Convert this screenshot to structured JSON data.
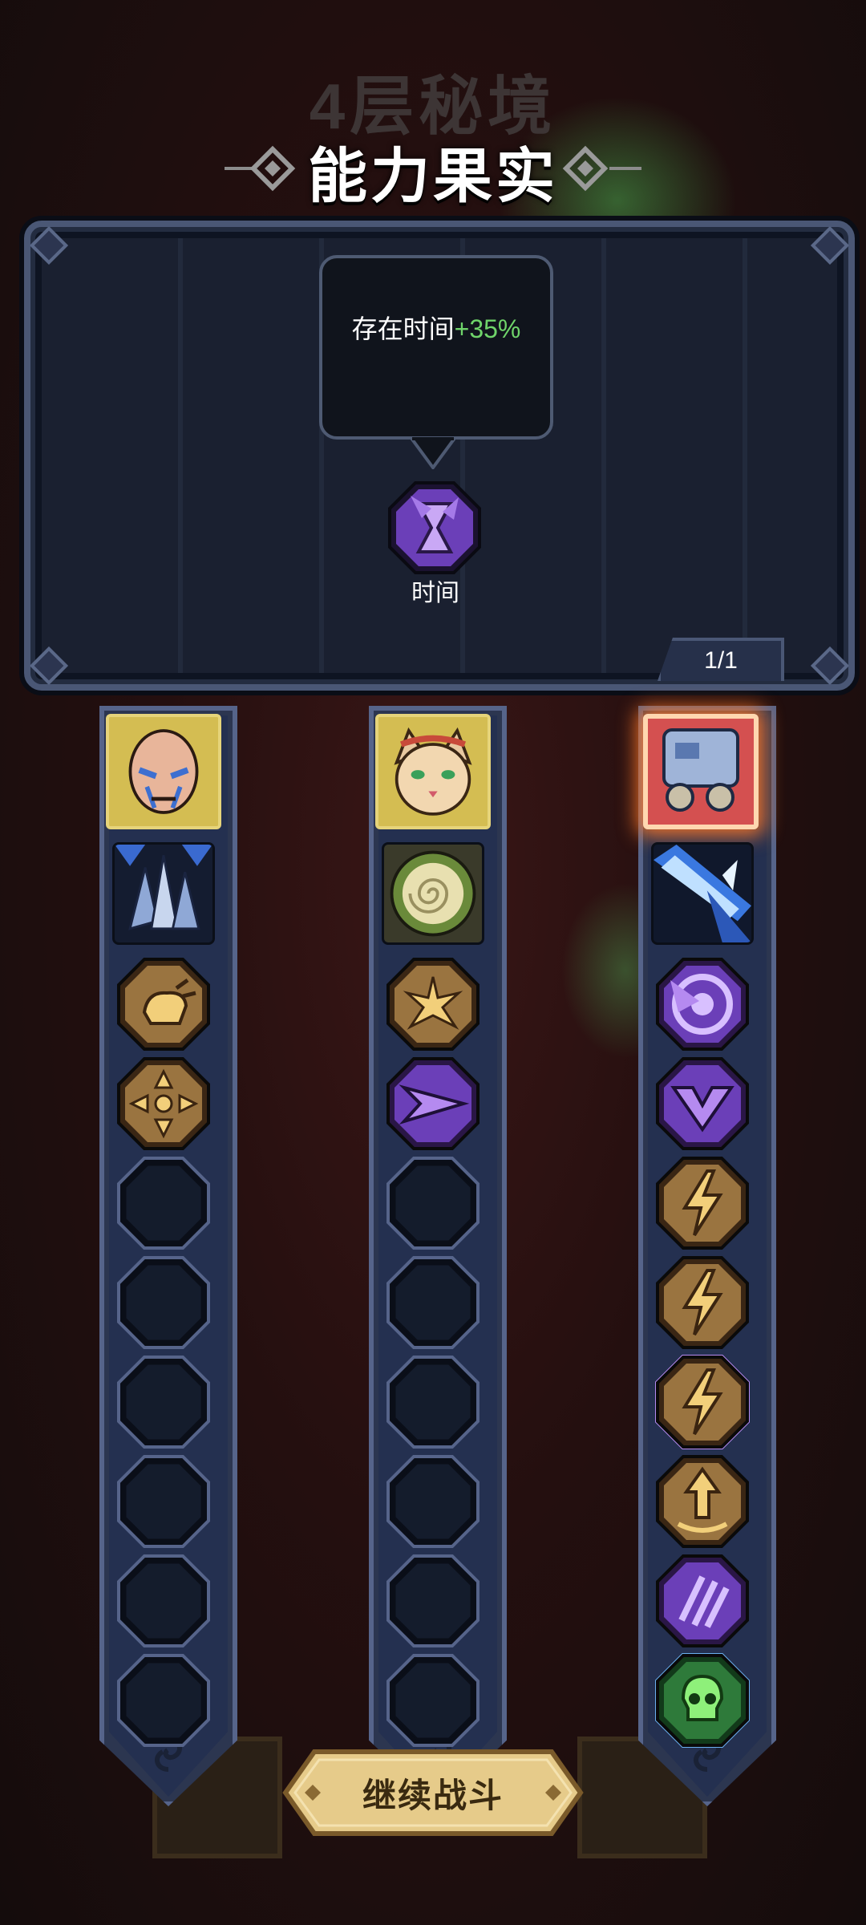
{
  "header": {
    "floor_title": "4层秘境",
    "main_title": "能力果实"
  },
  "fruit_panel": {
    "tooltip_prefix": "存在时间",
    "tooltip_bonus": "+35%",
    "selected_fruit_name": "时间",
    "selected_fruit_icon": "hourglass-icon",
    "selected_fruit_color": "#8a5ad8",
    "counter": "1/1"
  },
  "columns": [
    {
      "hero_icon": "bald-warrior-portrait",
      "skills": [
        "ice-crystal-skill-icon",
        "fist-icon",
        "four-arrows-icon"
      ],
      "empty_slots": 6
    },
    {
      "hero_icon": "lynx-portrait",
      "skills": [
        "swirl-orb-skill-icon",
        "burst-icon",
        "purple-arrow-icon"
      ],
      "empty_slots": 6
    },
    {
      "hero_icon": "mech-portrait",
      "skills": [
        "blue-slash-skill-icon",
        "purple-target-icon",
        "purple-chevron-icon",
        "lightning-icon",
        "lightning-icon",
        "lightning-icon",
        "up-arrow-icon",
        "purple-claw-icon",
        "green-skull-icon"
      ],
      "empty_slots": 0
    }
  ],
  "continue_button": "继续战斗",
  "colors": {
    "gold": "#c69a4a",
    "purple": "#8a5ad8",
    "green_text": "#6fd46a",
    "panel_border": "#4a5775"
  }
}
